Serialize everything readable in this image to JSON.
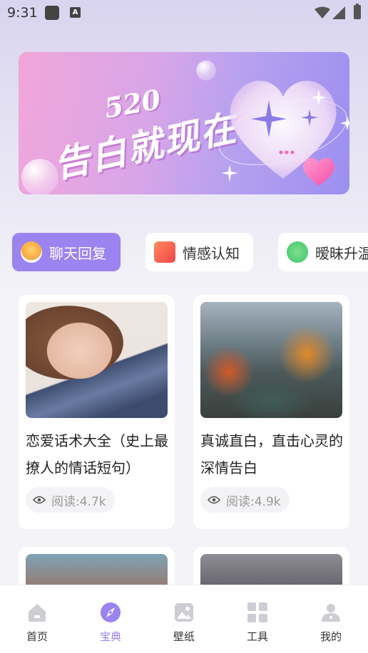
{
  "status_bar": {
    "time": "9:31"
  },
  "banner": {
    "number": "520",
    "slogan": "告白就现在"
  },
  "categories": [
    {
      "label": "聊天回复",
      "active": true
    },
    {
      "label": "情感认知",
      "active": false
    },
    {
      "label": "暧昧升温",
      "active": false
    }
  ],
  "cards": [
    {
      "title": "恋爱话术大全（史上最撩人的情话短句）",
      "reads": "阅读:4.7k"
    },
    {
      "title": "真诚直白，直击心灵的深情告白",
      "reads": "阅读:4.9k"
    }
  ],
  "bottom_nav": [
    {
      "label": "首页",
      "icon": "home-icon"
    },
    {
      "label": "宝典",
      "icon": "compass-icon"
    },
    {
      "label": "壁纸",
      "icon": "wallpaper-icon"
    },
    {
      "label": "工具",
      "icon": "grid-icon"
    },
    {
      "label": "我的",
      "icon": "user-icon"
    }
  ],
  "colors": {
    "accent": "#9b83f0",
    "text": "#222222",
    "muted": "#999999"
  }
}
